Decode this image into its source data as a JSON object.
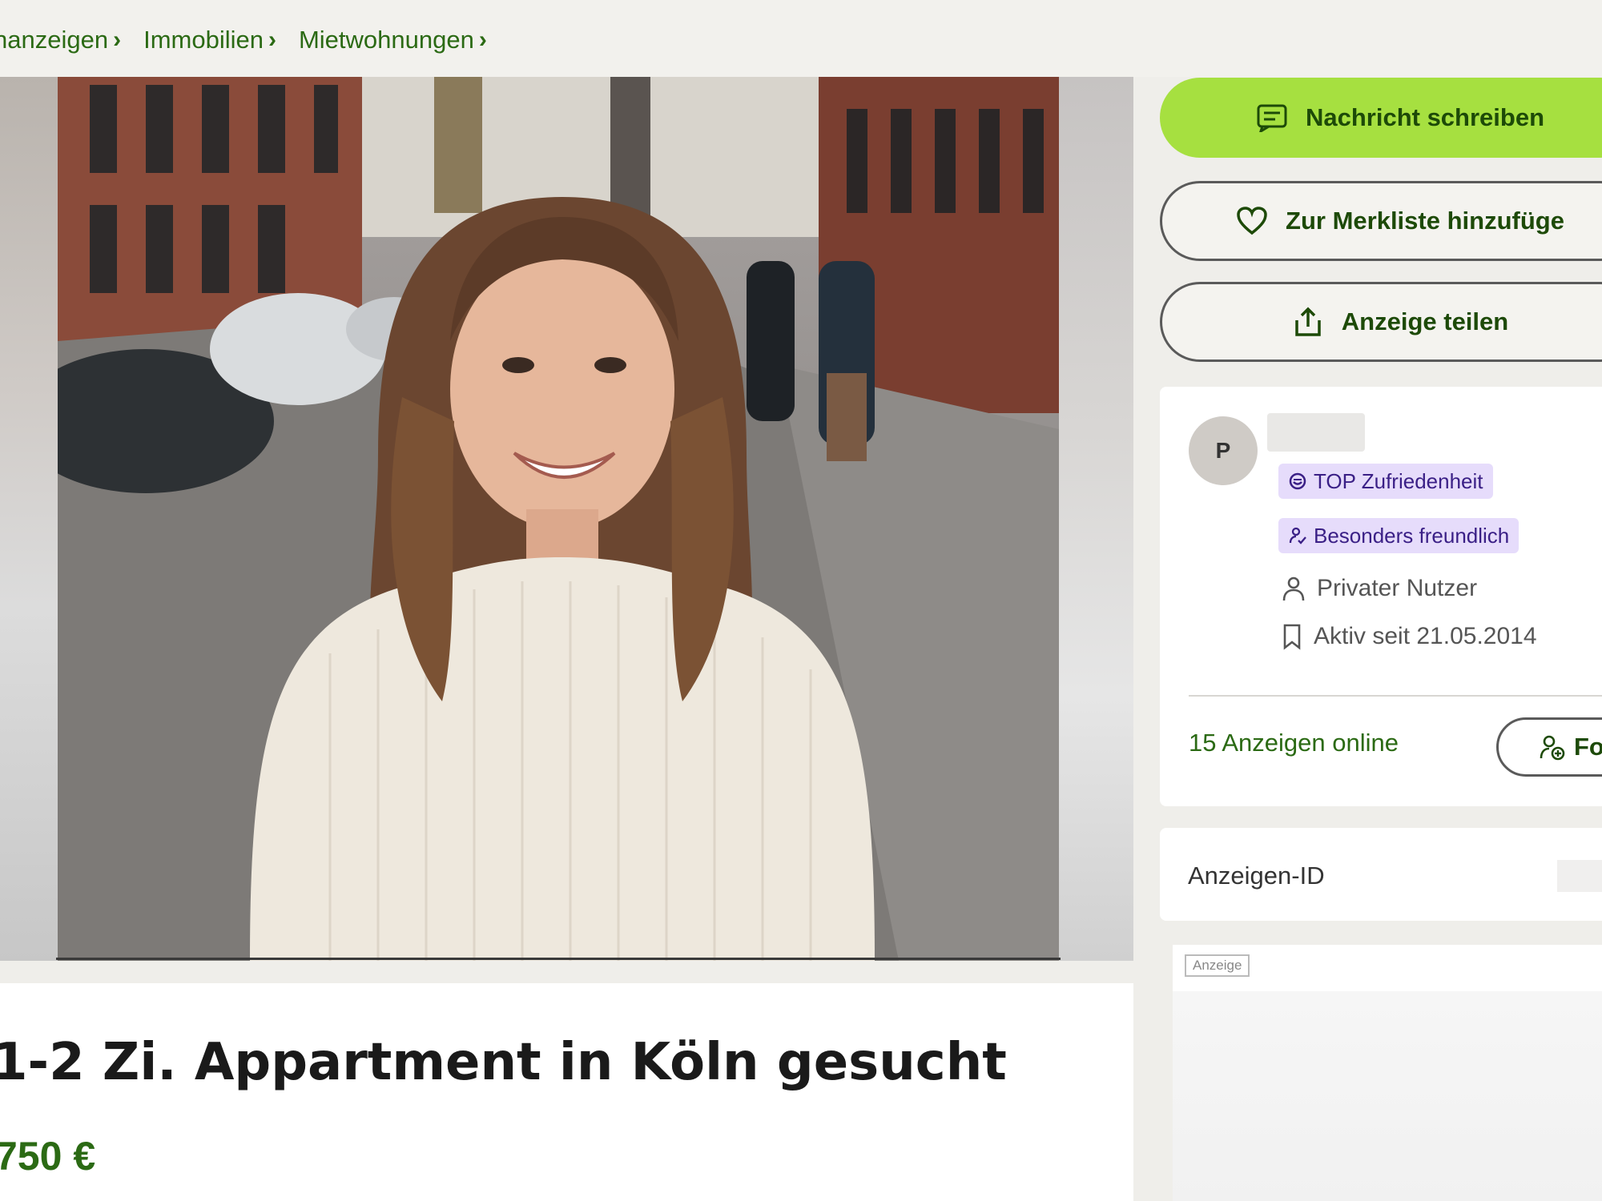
{
  "breadcrumb": [
    {
      "label": "nanzeigen"
    },
    {
      "label": "Immobilien"
    },
    {
      "label": "Mietwohnungen"
    }
  ],
  "listing": {
    "title": "1-2 Zi. Appartment in Köln gesucht",
    "price": "750 €"
  },
  "actions": {
    "message_label": "Nachricht schreiben",
    "favorite_label": "Zur Merkliste hinzufüge",
    "share_label": "Anzeige teilen"
  },
  "seller": {
    "avatar_initial": "P",
    "badges": [
      {
        "label": "TOP Zufriedenheit",
        "icon": "smiley-icon"
      },
      {
        "label": "Besonders freundlich",
        "icon": "friendly-user-icon"
      }
    ],
    "type": "Privater Nutzer",
    "active_since": "Aktiv seit 21.05.2014",
    "ads_online": "15 Anzeigen online",
    "follow_label": "Fo"
  },
  "ad_info": {
    "id_label": "Anzeigen-ID"
  },
  "advert": {
    "label": "Anzeige"
  },
  "colors": {
    "accent_green": "#a6e040",
    "link_green": "#2b6a14",
    "badge_bg": "#e6dcfb",
    "badge_text": "#3a1f86"
  }
}
